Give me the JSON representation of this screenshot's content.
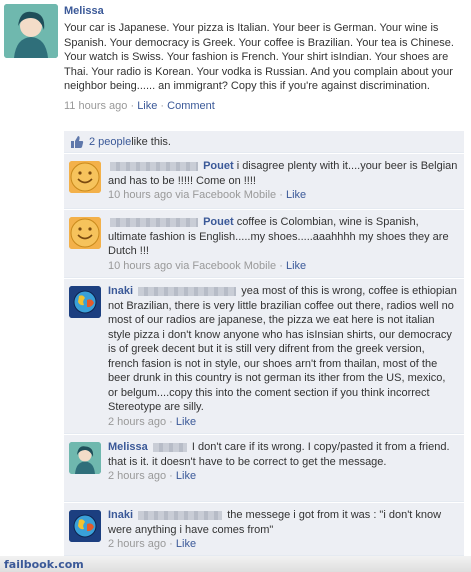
{
  "post": {
    "author": "Melissa",
    "text": "Your car is Japanese. Your pizza is Italian. Your beer is German. Your wine is Spanish. Your democracy is Greek. Your coffee is Brazilian. Your tea is Chinese. Your watch is Swiss. Your fashion is French. Your shirt isIndian. Your shoes are Thai. Your radio is Korean. Your vodka is Russian. And you complain about your neighbor being...... an immigrant? Copy this if you're against discrimination.",
    "time": "11 hours ago",
    "sep1": " · ",
    "like": "Like",
    "sep2": " · ",
    "comment": "Comment"
  },
  "likes": {
    "count_text": "2 people",
    "suffix": " like this.",
    "icon": "thumbs-up-icon"
  },
  "comments": [
    {
      "author": "Pouet",
      "text": "i disagree plenty with it....your beer is Belgian and has to be !!!!! Come on !!!!",
      "time": "10 hours ago via Facebook Mobile",
      "sep": " · ",
      "like": "Like"
    },
    {
      "author": "Pouet",
      "text": "coffee is Colombian, wine is Spanish, ultimate fashion is English.....my shoes.....aaahhhh my shoes they are Dutch !!!",
      "time": "10 hours ago via Facebook Mobile",
      "sep": " · ",
      "like": "Like"
    },
    {
      "author": "Inaki",
      "text": "yea most of this is wrong, coffee is ethiopian not Brazilian, there is very little brazilian coffee out there, radios well no most of our radios are japanese, the pizza we eat here is not italian style pizza i don't know anyone who has isInsian shirts, our democracy is of greek decent but it is still very difrent from the greek version, french fasion is not in style, our shoes arn't from thailan, most of the beer drunk in this country is not german its ither from the US, mexico, or belgum....copy this into the coment section if you think incorrect Stereotype are silly.",
      "time": "2 hours ago",
      "sep": " · ",
      "like": "Like"
    },
    {
      "author": "Melissa",
      "text": "I don't care if its wrong. I copy/pasted it from a friend. that is it. it doesn't have to be correct to get the message.",
      "time": "2 hours ago",
      "sep": " · ",
      "like": "Like"
    },
    {
      "author": "Inaki",
      "text": "the messege i got from it was : \"i don't know were anything i have comes from\"",
      "time": "2 hours ago",
      "sep": " · ",
      "like": "Like"
    }
  ],
  "footer": {
    "site": "failbook.com"
  },
  "colors": {
    "link": "#3b5998",
    "comment_bg": "#edeff4",
    "meta": "#999999"
  }
}
